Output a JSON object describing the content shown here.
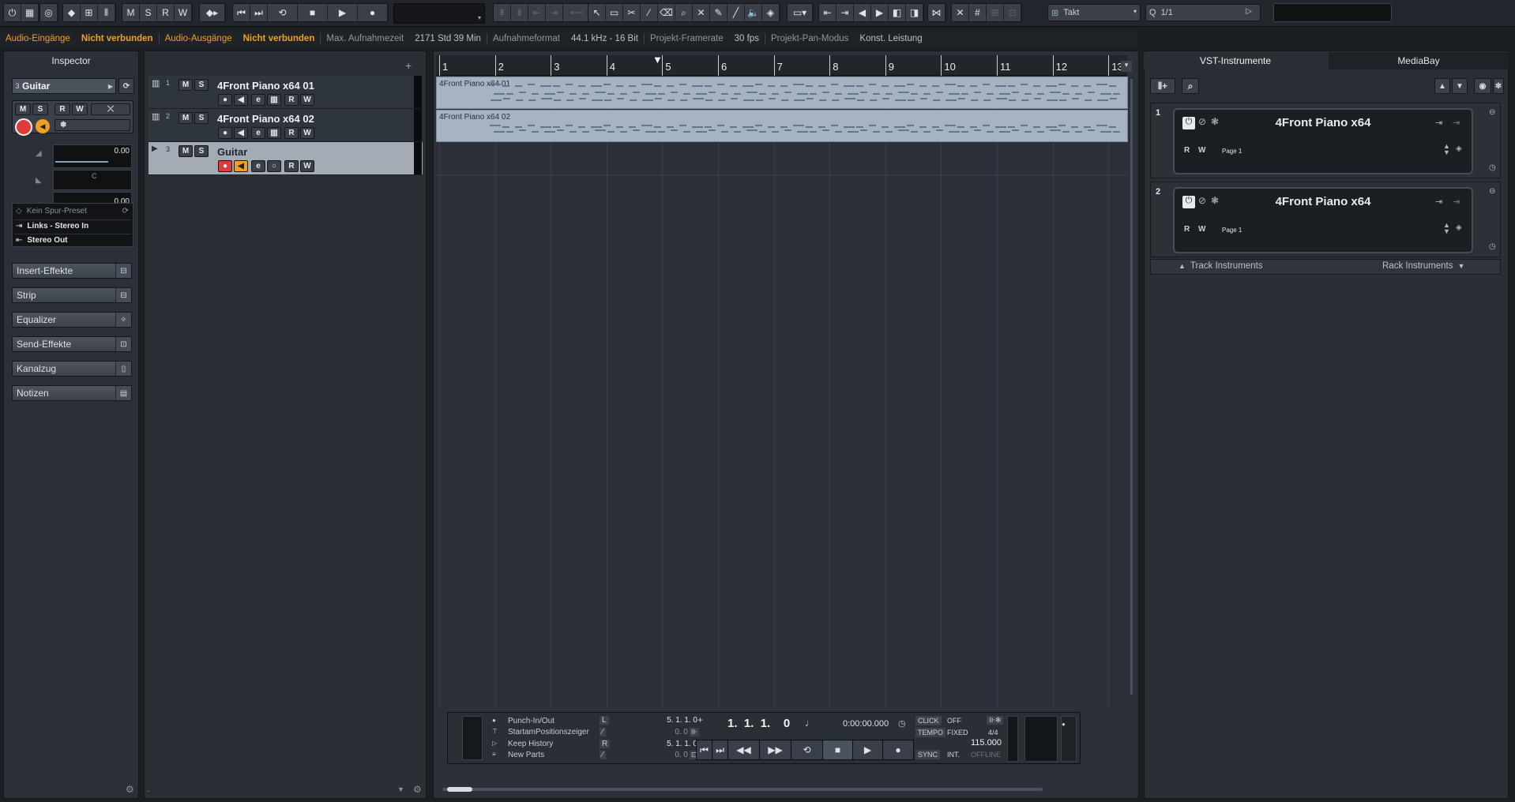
{
  "toolbar": {
    "mode_m": "M",
    "mode_s": "S",
    "mode_r": "R",
    "mode_w": "W",
    "grid_type": "Takt",
    "quantize": "1/1"
  },
  "status": {
    "audio_in_label": "Audio-Eingänge",
    "audio_in_value": "Nicht verbunden",
    "audio_out_label": "Audio-Ausgänge",
    "audio_out_value": "Nicht verbunden",
    "rec_time_label": "Max. Aufnahmezeit",
    "rec_time_value": "2171 Std 39 Min",
    "rec_format_label": "Aufnahmeformat",
    "rec_format_value": "44.1 kHz - 16 Bit",
    "framerate_label": "Projekt-Framerate",
    "framerate_value": "30 fps",
    "pan_label": "Projekt-Pan-Modus",
    "pan_value": "Konst. Leistung"
  },
  "colors": {
    "accent": "#f0a020",
    "record": "#e03b3b",
    "part": "#a5b3c3"
  },
  "inspector": {
    "title": "Inspector",
    "track_num": "3",
    "track_name": "Guitar",
    "btn_m": "M",
    "btn_s": "S",
    "btn_r": "R",
    "btn_w": "W",
    "volume": "0.00",
    "pan_label": "C",
    "delay": "0.00",
    "preset": "Kein Spur-Preset",
    "input": "Links - Stereo In",
    "output": "Stereo Out",
    "sections": [
      "Insert-Effekte",
      "Strip",
      "Equalizer",
      "Send-Effekte",
      "Kanalzug",
      "Notizen"
    ]
  },
  "tracks": [
    {
      "num": "1",
      "name": "4Front Piano x64 01",
      "m": "M",
      "s": "S",
      "r": "R",
      "w": "W"
    },
    {
      "num": "2",
      "name": "4Front Piano x64 02",
      "m": "M",
      "s": "S",
      "r": "R",
      "w": "W"
    },
    {
      "num": "3",
      "name": "Guitar",
      "m": "M",
      "s": "S",
      "r": "R",
      "w": "W"
    }
  ],
  "ruler": [
    "1",
    "2",
    "3",
    "4",
    "5",
    "6",
    "7",
    "8",
    "9",
    "10",
    "11",
    "12",
    "13"
  ],
  "parts": [
    {
      "label": "4Front Piano x64 01"
    },
    {
      "label": "4Front Piano x64 02"
    }
  ],
  "transport": {
    "punch": "Punch-In/Out",
    "start_pos": "StartamPositionszeiger",
    "keep_history": "Keep History",
    "new_parts": "New Parts",
    "left_locator": "5.  1.  1.    0",
    "left_sub": "0.    0",
    "right_locator": "5.  1.  1.    0",
    "right_sub": "0.    0",
    "position": "1.  1.  1.    0",
    "time": "0:00:00.000",
    "click_label": "CLICK",
    "click_value": "OFF",
    "tempo_label": "TEMPO",
    "tempo_mode": "FIXED",
    "signature": "4/4",
    "tempo_value": "115.000",
    "sync_label": "SYNC",
    "sync_mode": "INT.",
    "sync_state": "OFFLINE"
  },
  "right_panel": {
    "tab_vst": "VST-Instrumente",
    "tab_mediabay": "MediaBay",
    "slots": [
      {
        "num": "1",
        "name": "4Front Piano x64",
        "r": "R",
        "w": "W",
        "page": "Page 1"
      },
      {
        "num": "2",
        "name": "4Front Piano x64",
        "r": "R",
        "w": "W",
        "page": "Page 1"
      }
    ],
    "track_instruments": "Track Instruments",
    "rack_instruments": "Rack Instruments"
  }
}
